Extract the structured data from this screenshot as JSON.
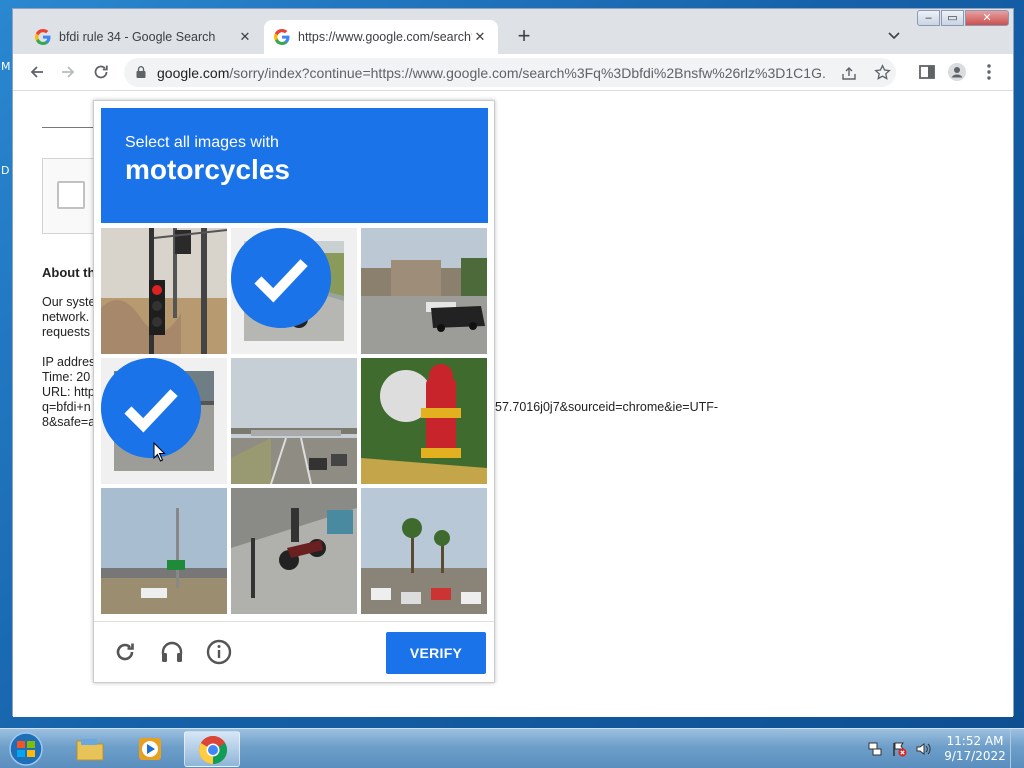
{
  "desktop": {
    "frag_top": "M",
    "frag_mid": "D"
  },
  "browser": {
    "tabs": [
      {
        "label": "bfdi rule 34 - Google Search",
        "close": "✕"
      },
      {
        "label": "https://www.google.com/search?",
        "close": "✕"
      }
    ],
    "new_tab": "+",
    "window_buttons": {
      "minimize": "–",
      "maximize": "▭",
      "close": "✕"
    },
    "address": {
      "host": "google.com",
      "path": "/sorry/index?continue=https://www.google.com/search%3Fq%3Dbfdi%2Bnsfw%26rlz%3D1C1G..."
    }
  },
  "page": {
    "about_heading": "About th",
    "para_lines": [
      "Our syste",
      "network.",
      "requests"
    ],
    "ip_lines": [
      "IP addres",
      "Time: 20",
      "URL: http",
      "q=bfdi+n",
      "8&safe=a"
    ],
    "url_overflow": "57.7016j0j7&sourceid=chrome&ie=UTF-"
  },
  "captcha": {
    "instruction": "Select all images with",
    "target": "motorcycles",
    "tiles": [
      {
        "name": "traffic-light",
        "selected": false
      },
      {
        "name": "motorcycle-rider-road",
        "selected": true
      },
      {
        "name": "street-building",
        "selected": false
      },
      {
        "name": "motorcycle-street",
        "selected": true
      },
      {
        "name": "highway",
        "selected": false
      },
      {
        "name": "fire-hydrant",
        "selected": false
      },
      {
        "name": "road-sign",
        "selected": false
      },
      {
        "name": "scooter-sidewalk",
        "selected": false
      },
      {
        "name": "palm-trees-parking",
        "selected": false
      }
    ],
    "verify_label": "VERIFY"
  },
  "taskbar": {
    "clock_time": "11:52 AM",
    "clock_date": "9/17/2022"
  },
  "colors": {
    "accent": "#1a73e8",
    "header_blue": "#1a73e8"
  }
}
